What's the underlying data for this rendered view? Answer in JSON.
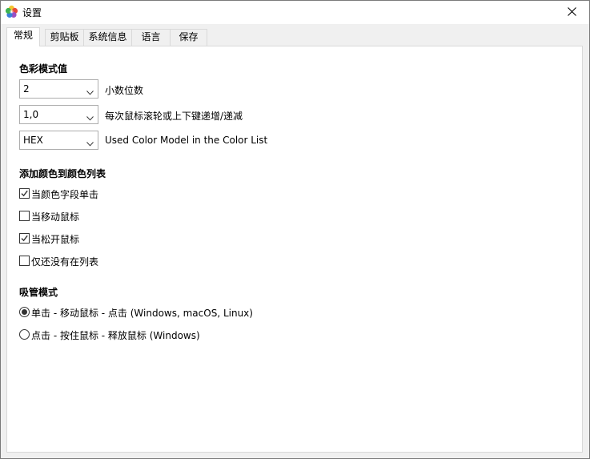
{
  "window": {
    "title": "设置"
  },
  "tabs": [
    {
      "label": "常规",
      "active": true
    },
    {
      "label": "剪贴板",
      "active": false
    },
    {
      "label": "系统信息",
      "active": false
    },
    {
      "label": "语言",
      "active": false
    },
    {
      "label": "保存",
      "active": false
    }
  ],
  "color_model_section": {
    "title": "色彩模式值",
    "decimals": {
      "value": "2",
      "label": "小数位数"
    },
    "step": {
      "value": "1,0",
      "label": "每次鼠标滚轮或上下键递增/递减"
    },
    "model": {
      "value": "HEX",
      "label": "Used Color Model in the Color List"
    }
  },
  "add_color_section": {
    "title": "添加颜色到颜色列表",
    "options": [
      {
        "label": "当颜色字段单击",
        "checked": true
      },
      {
        "label": "当移动鼠标",
        "checked": false
      },
      {
        "label": "当松开鼠标",
        "checked": true
      },
      {
        "label": "仅还没有在列表",
        "checked": false
      }
    ]
  },
  "picker_mode_section": {
    "title": "吸管模式",
    "options": [
      {
        "label": "单击 - 移动鼠标 - 点击 (Windows, macOS, Linux)",
        "selected": true
      },
      {
        "label": "点击 - 按住鼠标 - 释放鼠标 (Windows)",
        "selected": false
      }
    ]
  },
  "icons": {
    "app": "color-palette-icon",
    "close": "close-icon",
    "dropdown": "chevron-down-icon",
    "check": "check-mark-icon"
  }
}
